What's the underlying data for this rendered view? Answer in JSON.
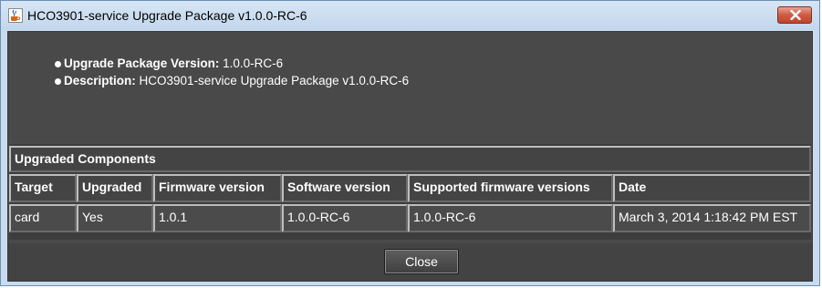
{
  "window": {
    "title": "HCO3901-service Upgrade Package v1.0.0-RC-6"
  },
  "info": {
    "version_label": "Upgrade Package Version:",
    "version_value": "1.0.0-RC-6",
    "description_label": "Description:",
    "description_value": "HCO3901-service Upgrade Package v1.0.0-RC-6"
  },
  "table": {
    "caption": "Upgraded Components",
    "columns": [
      "Target",
      "Upgraded",
      "Firmware version",
      "Software version",
      "Supported firmware versions",
      "Date"
    ],
    "rows": [
      [
        "card",
        "Yes",
        "1.0.1",
        "1.0.0-RC-6",
        "1.0.0-RC-6",
        "March 3, 2014 1:18:42 PM EST"
      ]
    ]
  },
  "buttons": {
    "close_label": "Close"
  },
  "icons": {
    "app": "java-coffee-cup-icon",
    "window_close": "close-icon"
  },
  "colors": {
    "panel": "#4a4a4a",
    "titlebar": "#c9dcef",
    "close_red": "#c2432a"
  }
}
